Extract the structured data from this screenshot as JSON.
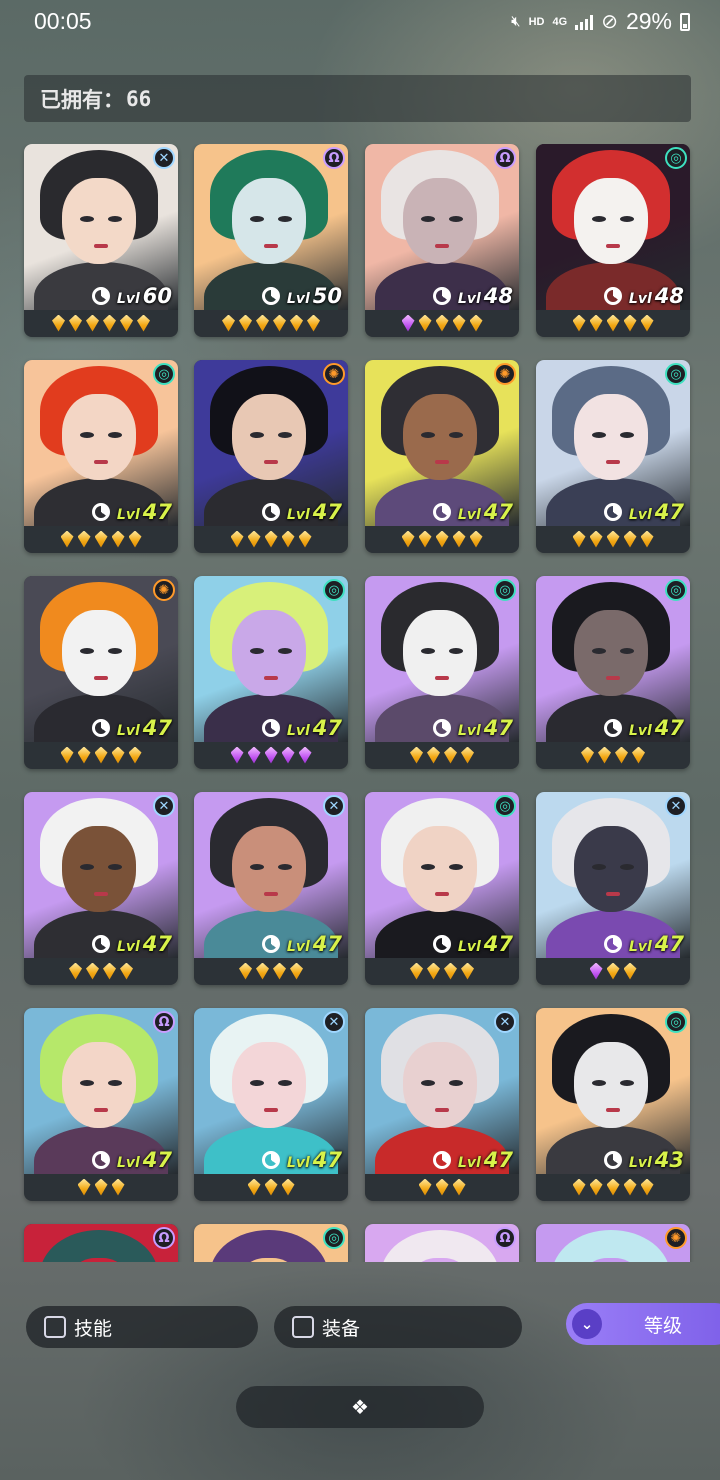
{
  "status_bar": {
    "time": "00:05",
    "network_label": "HD",
    "signal_label": "4G",
    "battery_percent": "29%"
  },
  "owned": {
    "label": "已拥有：",
    "count": "66"
  },
  "level_prefix": "Lvl",
  "cards": [
    {
      "level": "60",
      "gem_count": 6,
      "gem_color": "gold",
      "class_icon": "cross-class-icon",
      "badge_color": "#9fd6ff",
      "badge_glyph": "✕",
      "palette": [
        "#e9e3dd",
        "#2a2a2e",
        "#f3d9c8",
        "#3a3a3f"
      ]
    },
    {
      "level": "50",
      "gem_count": 6,
      "gem_color": "gold",
      "class_icon": "omega-class-icon",
      "badge_color": "#c89cff",
      "badge_glyph": "Ω",
      "palette": [
        "#f6c38b",
        "#1f7a5a",
        "#d6e6e9",
        "#2a3b39"
      ]
    },
    {
      "level": "48",
      "gem_count": 5,
      "gem_color": "gold",
      "first_gem_purple": true,
      "class_icon": "omega-class-icon",
      "badge_color": "#c89cff",
      "badge_glyph": "Ω",
      "palette": [
        "#f0b7a6",
        "#e9e4e3",
        "#c9b3b6",
        "#3d2f4a"
      ]
    },
    {
      "level": "48",
      "gem_count": 5,
      "gem_color": "gold",
      "class_icon": "spiral-class-icon",
      "badge_color": "#3ee0c0",
      "badge_glyph": "◎",
      "palette": [
        "#2a1a2a",
        "#d22f2f",
        "#f4f2ef",
        "#7a2a2a"
      ]
    },
    {
      "level": "47",
      "gem_count": 5,
      "gem_color": "gold",
      "class_icon": "spiral-class-icon",
      "badge_color": "#3ee0c0",
      "badge_glyph": "◎",
      "palette": [
        "#f7c49a",
        "#e13c1e",
        "#f3d6c5",
        "#2e2e33"
      ]
    },
    {
      "level": "47",
      "gem_count": 5,
      "gem_color": "gold",
      "class_icon": "wheel-class-icon",
      "badge_color": "#ff9a2a",
      "badge_glyph": "✺",
      "palette": [
        "#3e3a9a",
        "#111118",
        "#e8c8b4",
        "#2b2b30"
      ]
    },
    {
      "level": "47",
      "gem_count": 5,
      "gem_color": "gold",
      "class_icon": "wheel-class-icon",
      "badge_color": "#ff9a2a",
      "badge_glyph": "✺",
      "palette": [
        "#e7e25a",
        "#2f2e34",
        "#9a6a4c",
        "#5d4a7a"
      ]
    },
    {
      "level": "47",
      "gem_count": 5,
      "gem_color": "gold",
      "class_icon": "spiral-class-icon",
      "badge_color": "#3ee0c0",
      "badge_glyph": "◎",
      "palette": [
        "#c9d6e8",
        "#5b6b86",
        "#f2e2e2",
        "#3a3f55"
      ]
    },
    {
      "level": "47",
      "gem_count": 5,
      "gem_color": "gold",
      "class_icon": "wheel-class-icon",
      "badge_color": "#ff9a2a",
      "badge_glyph": "✺",
      "palette": [
        "#4a4a55",
        "#f08a1e",
        "#f2f2f2",
        "#2a2a30"
      ]
    },
    {
      "level": "47",
      "gem_count": 5,
      "gem_color": "purple",
      "class_icon": "spiral-class-icon",
      "badge_color": "#3ee0c0",
      "badge_glyph": "◎",
      "palette": [
        "#8fd0e8",
        "#d8f07a",
        "#c9a8e8",
        "#3a2f4a"
      ]
    },
    {
      "level": "47",
      "gem_count": 4,
      "gem_color": "gold",
      "class_icon": "spiral-class-icon",
      "badge_color": "#3ee0c0",
      "badge_glyph": "◎",
      "palette": [
        "#c59af0",
        "#2a2a2e",
        "#f0f0f0",
        "#5b4a6a"
      ]
    },
    {
      "level": "47",
      "gem_count": 4,
      "gem_color": "gold",
      "class_icon": "spiral-class-icon",
      "badge_color": "#3ee0c0",
      "badge_glyph": "◎",
      "palette": [
        "#c59af0",
        "#1a1a1f",
        "#7a6a6a",
        "#2a2a30"
      ]
    },
    {
      "level": "47",
      "gem_count": 4,
      "gem_color": "gold",
      "class_icon": "cross-class-icon",
      "badge_color": "#9fd6ff",
      "badge_glyph": "✕",
      "palette": [
        "#c59af0",
        "#f2f2f2",
        "#7a5238",
        "#2e2e33"
      ]
    },
    {
      "level": "47",
      "gem_count": 4,
      "gem_color": "gold",
      "class_icon": "cross-class-icon",
      "badge_color": "#9fd6ff",
      "badge_glyph": "✕",
      "palette": [
        "#c59af0",
        "#2a2a30",
        "#c98f7a",
        "#4a8a98"
      ]
    },
    {
      "level": "47",
      "gem_count": 4,
      "gem_color": "gold",
      "class_icon": "spiral-class-icon",
      "badge_color": "#3ee0c0",
      "badge_glyph": "◎",
      "palette": [
        "#c59af0",
        "#f0f0f0",
        "#f0d3c5",
        "#1a1a1f"
      ]
    },
    {
      "level": "47",
      "gem_count": 3,
      "gem_color": "gold",
      "first_gem_purple": true,
      "class_icon": "cross-class-icon",
      "badge_color": "#9fd6ff",
      "badge_glyph": "✕",
      "palette": [
        "#bcd9ee",
        "#e6e6ea",
        "#3a3a4a",
        "#7a4ab0"
      ]
    },
    {
      "level": "47",
      "gem_count": 3,
      "gem_color": "gold",
      "class_icon": "omega-class-icon",
      "badge_color": "#c89cff",
      "badge_glyph": "Ω",
      "palette": [
        "#7ab8d8",
        "#b6e86a",
        "#f3d6c8",
        "#5a3a5a"
      ]
    },
    {
      "level": "47",
      "gem_count": 3,
      "gem_color": "gold",
      "class_icon": "cross-class-icon",
      "badge_color": "#9fd6ff",
      "badge_glyph": "✕",
      "palette": [
        "#7ab8d8",
        "#e8f3f3",
        "#f3d6d8",
        "#3ec0c8"
      ]
    },
    {
      "level": "47",
      "gem_count": 3,
      "gem_color": "gold",
      "class_icon": "cross-class-icon",
      "badge_color": "#9fd6ff",
      "badge_glyph": "✕",
      "palette": [
        "#7ab8d8",
        "#e0e0e4",
        "#e8d0d0",
        "#c82a2a"
      ]
    },
    {
      "level": "43",
      "gem_count": 5,
      "gem_color": "gold",
      "class_icon": "spiral-class-icon",
      "badge_color": "#3ee0c0",
      "badge_glyph": "◎",
      "palette": [
        "#f6c38b",
        "#1a1a1f",
        "#e8e8ea",
        "#3a3a40"
      ]
    },
    {
      "level": "",
      "gem_count": 0,
      "gem_color": "gold",
      "class_icon": "omega-class-icon",
      "badge_color": "#c89cff",
      "badge_glyph": "Ω",
      "palette": [
        "#c8223a",
        "#2a5a5a",
        "#c8223a",
        "#2a2a30"
      ]
    },
    {
      "level": "",
      "gem_count": 0,
      "gem_color": "gold",
      "class_icon": "spiral-class-icon",
      "badge_color": "#3ee0c0",
      "badge_glyph": "◎",
      "palette": [
        "#f6c38b",
        "#5a3a7a",
        "#f6c38b",
        "#2a2a30"
      ]
    },
    {
      "level": "",
      "gem_count": 0,
      "gem_color": "gold",
      "class_icon": "omega-class-icon",
      "badge_color": "#c89cff",
      "badge_glyph": "Ω",
      "palette": [
        "#d8a8f0",
        "#f0e8f0",
        "#d8a8f0",
        "#2a2a30"
      ]
    },
    {
      "level": "",
      "gem_count": 0,
      "gem_color": "gold",
      "class_icon": "wheel-class-icon",
      "badge_color": "#ff9a2a",
      "badge_glyph": "✺",
      "palette": [
        "#c59af0",
        "#bfe8f0",
        "#c59af0",
        "#2a2a30"
      ]
    }
  ],
  "filters": {
    "skill_label": "技能",
    "skill_checked": false,
    "equipment_label": "装备",
    "equipment_checked": false,
    "sort_label": "等级",
    "sort_icon": "double-chevron-down-icon"
  },
  "collapse": {
    "icon": "diamond-cluster-icon"
  }
}
